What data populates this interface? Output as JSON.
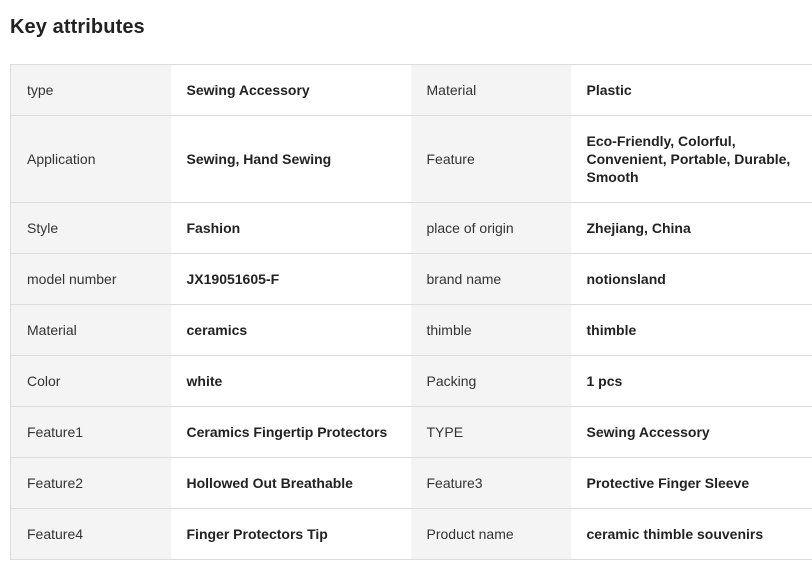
{
  "section": {
    "title": "Key attributes"
  },
  "attributes": {
    "rows": [
      [
        {
          "key": "type",
          "value": "Sewing Accessory"
        },
        {
          "key": "Material",
          "value": "Plastic"
        }
      ],
      [
        {
          "key": "Application",
          "value": "Sewing, Hand Sewing"
        },
        {
          "key": "Feature",
          "value": "Eco-Friendly, Colorful, Convenient, Portable, Durable, Smooth"
        }
      ],
      [
        {
          "key": "Style",
          "value": "Fashion"
        },
        {
          "key": "place of origin",
          "value": "Zhejiang, China"
        }
      ],
      [
        {
          "key": "model number",
          "value": "JX19051605-F"
        },
        {
          "key": "brand name",
          "value": "notionsland"
        }
      ],
      [
        {
          "key": "Material",
          "value": "ceramics"
        },
        {
          "key": "thimble",
          "value": "thimble"
        }
      ],
      [
        {
          "key": "Color",
          "value": "white"
        },
        {
          "key": "Packing",
          "value": "1 pcs"
        }
      ],
      [
        {
          "key": "Feature1",
          "value": "Ceramics Fingertip Protectors"
        },
        {
          "key": "TYPE",
          "value": "Sewing Accessory"
        }
      ],
      [
        {
          "key": "Feature2",
          "value": "Hollowed Out Breathable"
        },
        {
          "key": "Feature3",
          "value": "Protective Finger Sleeve"
        }
      ],
      [
        {
          "key": "Feature4",
          "value": "Finger Protectors Tip"
        },
        {
          "key": "Product name",
          "value": "ceramic thimble souvenirs"
        }
      ]
    ]
  }
}
